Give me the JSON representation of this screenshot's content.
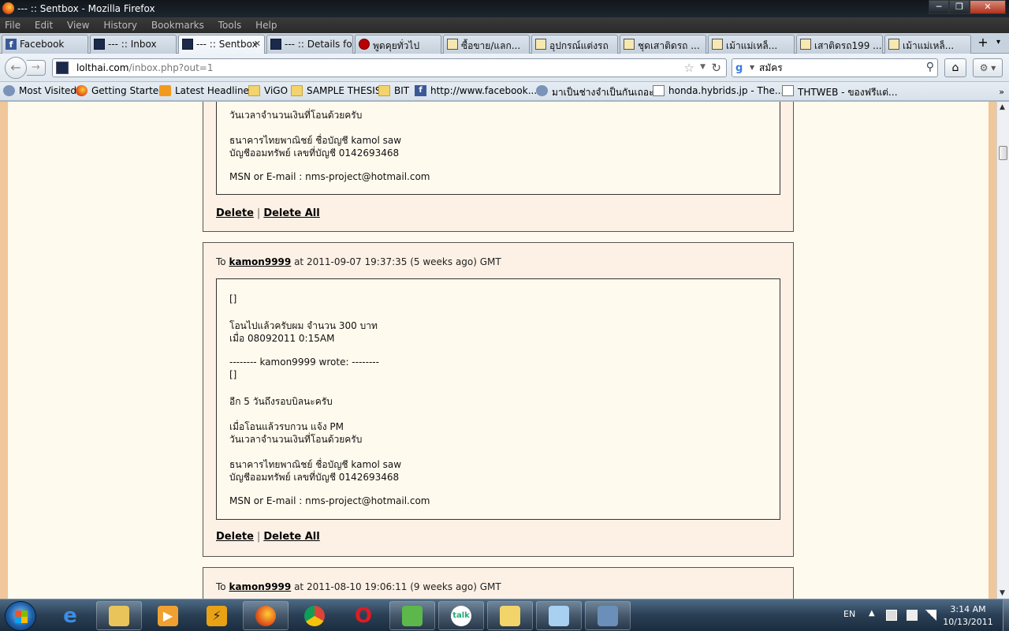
{
  "window": {
    "title": "--- :: Sentbox - Mozilla Firefox",
    "min": "─",
    "max": "❐",
    "close": "✕"
  },
  "menu": [
    "File",
    "Edit",
    "View",
    "History",
    "Bookmarks",
    "Tools",
    "Help"
  ],
  "tabs": [
    {
      "label": "Facebook",
      "icon": "facebook-icon"
    },
    {
      "label": "--- :: Inbox",
      "icon": "lol-icon"
    },
    {
      "label": "--- :: Sentbox",
      "icon": "lol-icon",
      "active": true
    },
    {
      "label": "--- :: Details fo...",
      "icon": "lol-icon"
    },
    {
      "label": "พูดคุยทั่วไป",
      "icon": "red-icon"
    },
    {
      "label": "ซื้อขาย/แลก...",
      "icon": "page-icon"
    },
    {
      "label": "อุปกรณ์แต่งรถ",
      "icon": "page-icon"
    },
    {
      "label": "ชุดเสาติดรถ ...",
      "icon": "page-icon"
    },
    {
      "label": "เม้าแม่เหล็...",
      "icon": "page-icon"
    },
    {
      "label": "เสาติดรถ199 ...",
      "icon": "page-icon"
    },
    {
      "label": "เม้าแม่เหล็...",
      "icon": "page-icon"
    }
  ],
  "tab_close": "✕",
  "newtab": "+",
  "nav": {
    "url_host": "lolthai.com",
    "url_rest": "/inbox.php?out=1",
    "search_value": "สมัคร",
    "back": "←",
    "forward": "→",
    "star": "☆",
    "reload": "↻",
    "home": "⌂",
    "mag": "⚲",
    "addon": "⚙ ▾"
  },
  "bookmarks": [
    {
      "label": "Most Visited",
      "icon": "globe-icon"
    },
    {
      "label": "Getting Started",
      "icon": "firefox-icon"
    },
    {
      "label": "Latest Headlines",
      "icon": "rss-icon"
    },
    {
      "label": "ViGO",
      "icon": "folder-icon"
    },
    {
      "label": "SAMPLE THESIS",
      "icon": "folder-icon"
    },
    {
      "label": "BIT",
      "icon": "folder-icon"
    },
    {
      "label": "http://www.facebook....",
      "icon": "facebook-icon"
    },
    {
      "label": "มาเป็นช่างจำเป็นกันเถอะ",
      "icon": "globe-icon"
    },
    {
      "label": "honda.hybrids.jp - The...",
      "icon": "page-icon"
    },
    {
      "label": "THTWEB - ของฟรีแต่...",
      "icon": "page-icon"
    }
  ],
  "bm_more": "»",
  "messages": [
    {
      "lines": [
        "วันเวลาจำนวนเงินที่โอนด้วยครับ",
        "",
        "ธนาคารไทยพาณิชย์ ชื่อบัญชี kamol saw",
        "บัญชีออมทรัพย์ เลขที่บัญชี 0142693468",
        "",
        "MSN or E-mail : nms-project@hotmail.com"
      ],
      "delete": "Delete",
      "delete_all": "Delete All",
      "sep": "|"
    },
    {
      "to_prefix": "To",
      "to_user": "kamon9999",
      "when": "at 2011-09-07 19:37:35 (5 weeks ago) GMT",
      "lines": [
        "[]",
        "",
        "โอนไปแล้วครับผม จำนวน 300 บาท",
        "เมื่อ 08092011 0:15AM",
        "",
        "-------- kamon9999 wrote: --------",
        "[]",
        "",
        "อีก 5 วันถึงรอบบิลนะครับ",
        "",
        "เมื่อโอนแล้วรบกวน แจ้ง PM",
        "วันเวลาจำนวนเงินที่โอนด้วยครับ",
        "",
        "ธนาคารไทยพาณิชย์ ชื่อบัญชี kamol saw",
        "บัญชีออมทรัพย์ เลขที่บัญชี 0142693468",
        "",
        "MSN or E-mail : nms-project@hotmail.com"
      ],
      "delete": "Delete",
      "delete_all": "Delete All",
      "sep": "|"
    },
    {
      "to_prefix": "To",
      "to_user": "kamon9999",
      "when": "at 2011-08-10 19:06:11 (9 weeks ago) GMT"
    }
  ],
  "taskbar": {
    "lang": "EN",
    "tray_arrow": "▲",
    "time": "3:14 AM",
    "date": "10/13/2011",
    "apps": [
      "ie-icon",
      "explorer-icon",
      "media-player-icon",
      "winamp-icon",
      "firefox-icon",
      "chrome-icon",
      "opera-icon",
      "messenger-icon",
      "gtalk-icon",
      "outlook-icon",
      "notepad-icon",
      "remote-desktop-icon"
    ]
  },
  "colors": {
    "page_bg": "#fffaee",
    "panel_bg": "#fdf1e6",
    "side": "#f0c79a"
  }
}
